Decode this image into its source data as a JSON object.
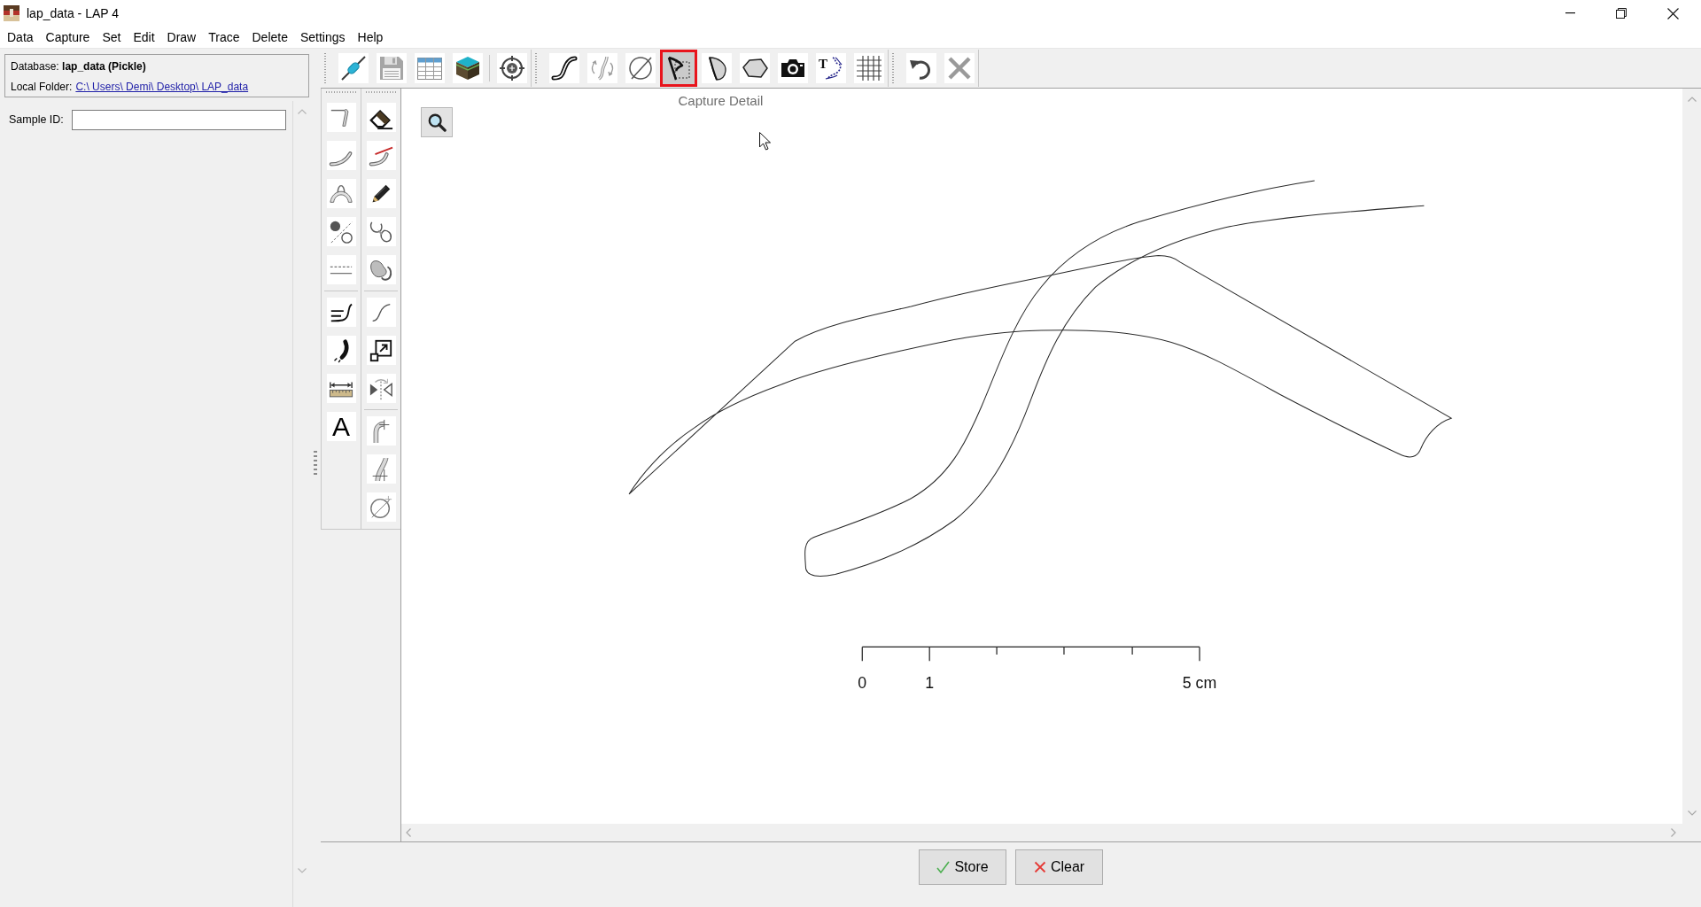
{
  "window": {
    "title": "lap_data - LAP 4"
  },
  "menu": [
    "Data",
    "Capture",
    "Set",
    "Edit",
    "Draw",
    "Trace",
    "Delete",
    "Settings",
    "Help"
  ],
  "info_panel": {
    "database": "Database: **lap_data (Pickle)**",
    "folder_label": "Local Folder:",
    "folder_link": "C:\\ Users\\ Demi\\ Desktop\\ LAP_data"
  },
  "sample_id": {
    "label": "Sample ID:"
  },
  "toolbars": [
    {
      "groups": [
        [
          {
            "kind": "capsule",
            "selected": false
          },
          {
            "kind": "save",
            "selected": false
          },
          {
            "kind": "table",
            "selected": false
          },
          {
            "kind": "cube",
            "selected": false
          }
        ],
        [
          {
            "kind": "crosshair",
            "selected": false
          }
        ]
      ]
    },
    {
      "groups": [
        [
          {
            "kind": "curve",
            "selected": false
          },
          {
            "kind": "curve-arrows",
            "selected": false
          },
          {
            "kind": "circle-slash",
            "selected": false
          },
          {
            "kind": "detail",
            "selected": true,
            "tooltip": "Capture Detail"
          },
          {
            "kind": "shape",
            "selected": false
          },
          {
            "kind": "polygon",
            "selected": false
          },
          {
            "kind": "camera",
            "selected": false
          },
          {
            "kind": "text-trace",
            "selected": false,
            "glyph": "T"
          },
          {
            "kind": "grid",
            "selected": false
          }
        ]
      ]
    },
    {
      "groups": [
        [
          {
            "kind": "undo",
            "selected": false
          },
          {
            "kind": "cancel",
            "selected": false
          }
        ]
      ]
    }
  ],
  "palette": {
    "columns": [
      {
        "groups": [
          [
            {
              "kind": "bracket",
              "selected": false
            },
            {
              "kind": "curve-band",
              "selected": false
            },
            {
              "kind": "arch",
              "selected": false
            },
            {
              "kind": "dot-circle",
              "selected": false
            },
            {
              "kind": "dashed-lines",
              "selected": false
            }
          ],
          [
            {
              "kind": "hook-curve",
              "selected": false
            },
            {
              "kind": "brush-stroke",
              "selected": false
            },
            {
              "kind": "ruler",
              "selected": false
            },
            {
              "kind": "letter",
              "selected": false,
              "glyph": "A"
            }
          ]
        ]
      },
      {
        "groups": [
          [
            {
              "kind": "eraser",
              "selected": false
            },
            {
              "kind": "curve-cut",
              "selected": false
            },
            {
              "kind": "pencil",
              "selected": false
            },
            {
              "kind": "loops",
              "selected": false
            },
            {
              "kind": "blob",
              "selected": false
            }
          ],
          [
            {
              "kind": "s-curve",
              "selected": false
            },
            {
              "kind": "resize",
              "selected": false
            },
            {
              "kind": "mirror",
              "selected": false
            }
          ],
          [
            {
              "kind": "bent-pipe",
              "selected": false
            },
            {
              "kind": "slanted-pipe",
              "selected": false
            },
            {
              "kind": "circle-cross",
              "selected": false
            }
          ]
        ]
      }
    ]
  },
  "canvas": {
    "scale_bar": {
      "labels": [
        "0",
        "1",
        "5 cm"
      ]
    }
  },
  "actions": [
    {
      "kind": "store",
      "label": "Store"
    },
    {
      "kind": "clear",
      "label": "Clear"
    }
  ]
}
